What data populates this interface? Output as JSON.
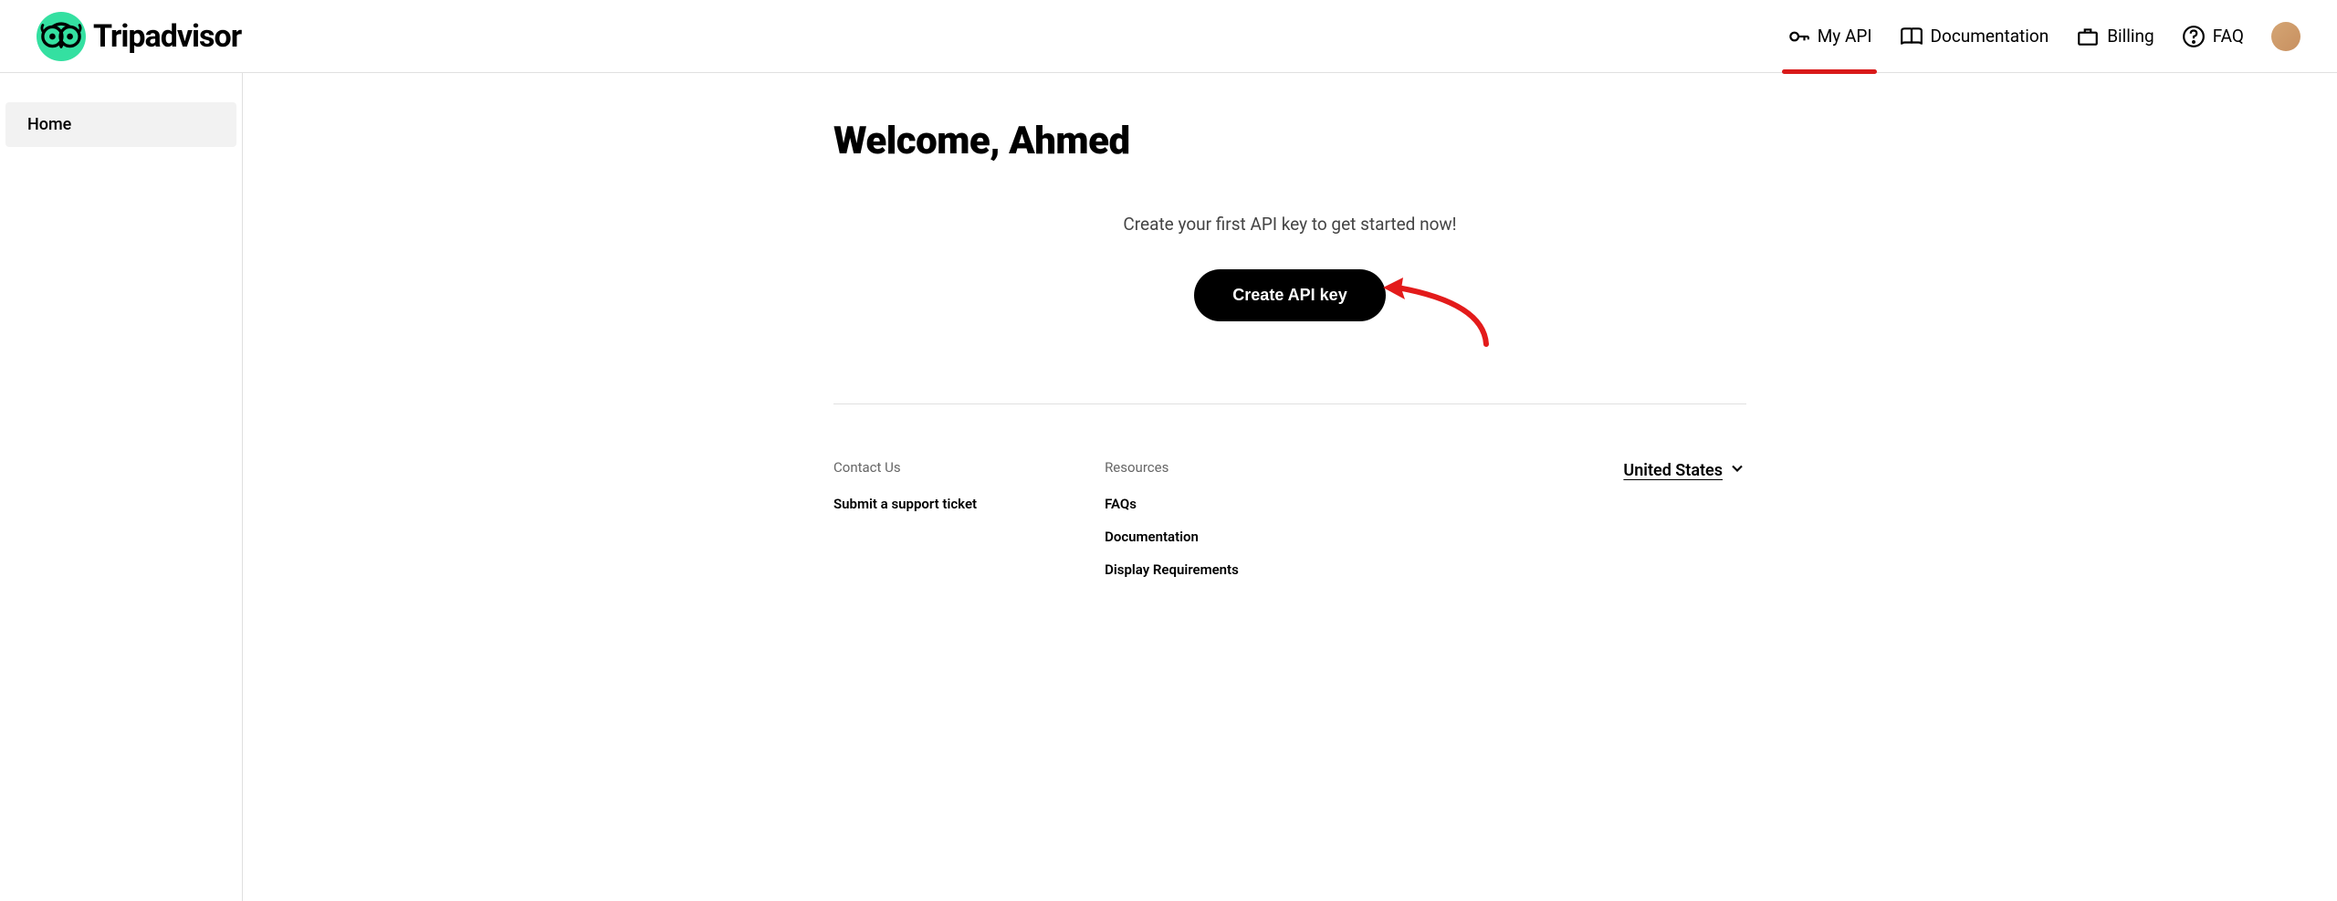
{
  "brand": {
    "name": "Tripadvisor"
  },
  "nav": {
    "items": [
      {
        "label": "My API",
        "icon": "key",
        "active": true
      },
      {
        "label": "Documentation",
        "icon": "book",
        "active": false
      },
      {
        "label": "Billing",
        "icon": "briefcase",
        "active": false
      },
      {
        "label": "FAQ",
        "icon": "help",
        "active": false
      }
    ]
  },
  "sidebar": {
    "items": [
      {
        "label": "Home",
        "active": true
      }
    ]
  },
  "main": {
    "title": "Welcome, Ahmed",
    "cta_text": "Create your first API key to get started now!",
    "cta_button": "Create API key"
  },
  "footer": {
    "columns": [
      {
        "title": "Contact Us",
        "links": [
          {
            "label": "Submit a support ticket"
          }
        ]
      },
      {
        "title": "Resources",
        "links": [
          {
            "label": "FAQs"
          },
          {
            "label": "Documentation"
          },
          {
            "label": "Display Requirements"
          }
        ]
      }
    ],
    "country": "United States"
  }
}
